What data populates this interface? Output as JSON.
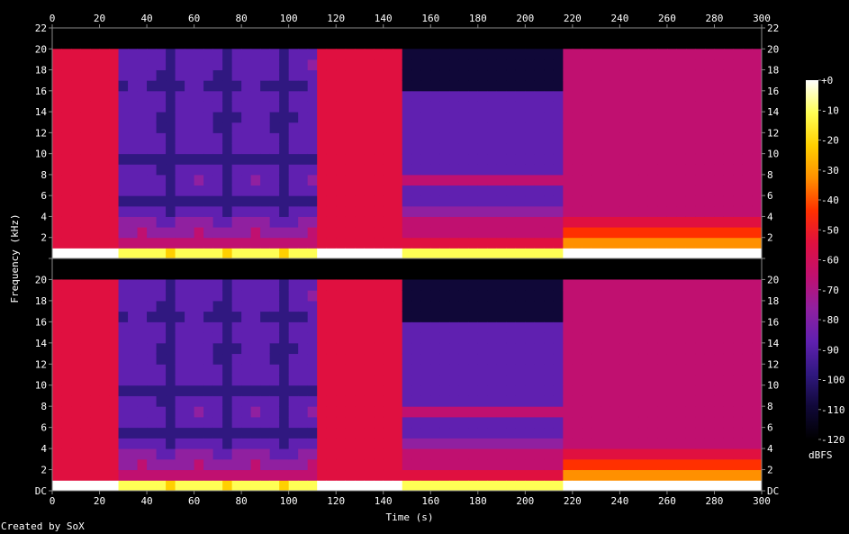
{
  "chart_data": {
    "type": "heatmap",
    "title": "",
    "xlabel": "Time (s)",
    "ylabel": "Frequency (kHz)",
    "xlim": [
      0,
      300
    ],
    "ylim": [
      0,
      22
    ],
    "x_ticks": [
      0,
      20,
      40,
      60,
      80,
      100,
      120,
      140,
      160,
      180,
      200,
      220,
      240,
      260,
      280,
      300
    ],
    "y_ticks": [
      0,
      2,
      4,
      6,
      8,
      10,
      12,
      14,
      16,
      18,
      20,
      22
    ],
    "y_tick_labels_top": [
      "",
      "2",
      "4",
      "6",
      "8",
      "10",
      "12",
      "14",
      "16",
      "18",
      "20",
      "22"
    ],
    "y_tick_labels_bottom": [
      "DC",
      "2",
      "4",
      "6",
      "8",
      "10",
      "12",
      "14",
      "16",
      "18",
      "20",
      ""
    ],
    "channels": 2,
    "max_frequency_khz": 20.2,
    "segments": [
      {
        "start": 0,
        "end": 30,
        "character": "broadband noise"
      },
      {
        "start": 30,
        "end": 114,
        "character": "sparse tonal"
      },
      {
        "start": 114,
        "end": 150,
        "character": "broadband noise"
      },
      {
        "start": 150,
        "end": 218,
        "character": "mid tonal"
      },
      {
        "start": 218,
        "end": 300,
        "character": "dense"
      }
    ],
    "colorbar": {
      "label": "dBFS",
      "range": [
        -120,
        0
      ],
      "ticks": [
        0,
        -10,
        -20,
        -30,
        -40,
        -50,
        -60,
        -70,
        -80,
        -90,
        -100,
        -110,
        -120
      ],
      "tick_labels": [
        "+0",
        "-10",
        "-20",
        "-30",
        "-40",
        "-50",
        "-60",
        "-70",
        "-80",
        "-90",
        "-100",
        "-110",
        "-120"
      ],
      "colors": [
        "#ffffff",
        "#ffff55",
        "#ffd000",
        "#ff9000",
        "#ff3000",
        "#e01040",
        "#c01070",
        "#9020a0",
        "#6020b0",
        "#301880",
        "#100838",
        "#000000"
      ]
    }
  },
  "footer": {
    "credit": "Created by SoX"
  }
}
